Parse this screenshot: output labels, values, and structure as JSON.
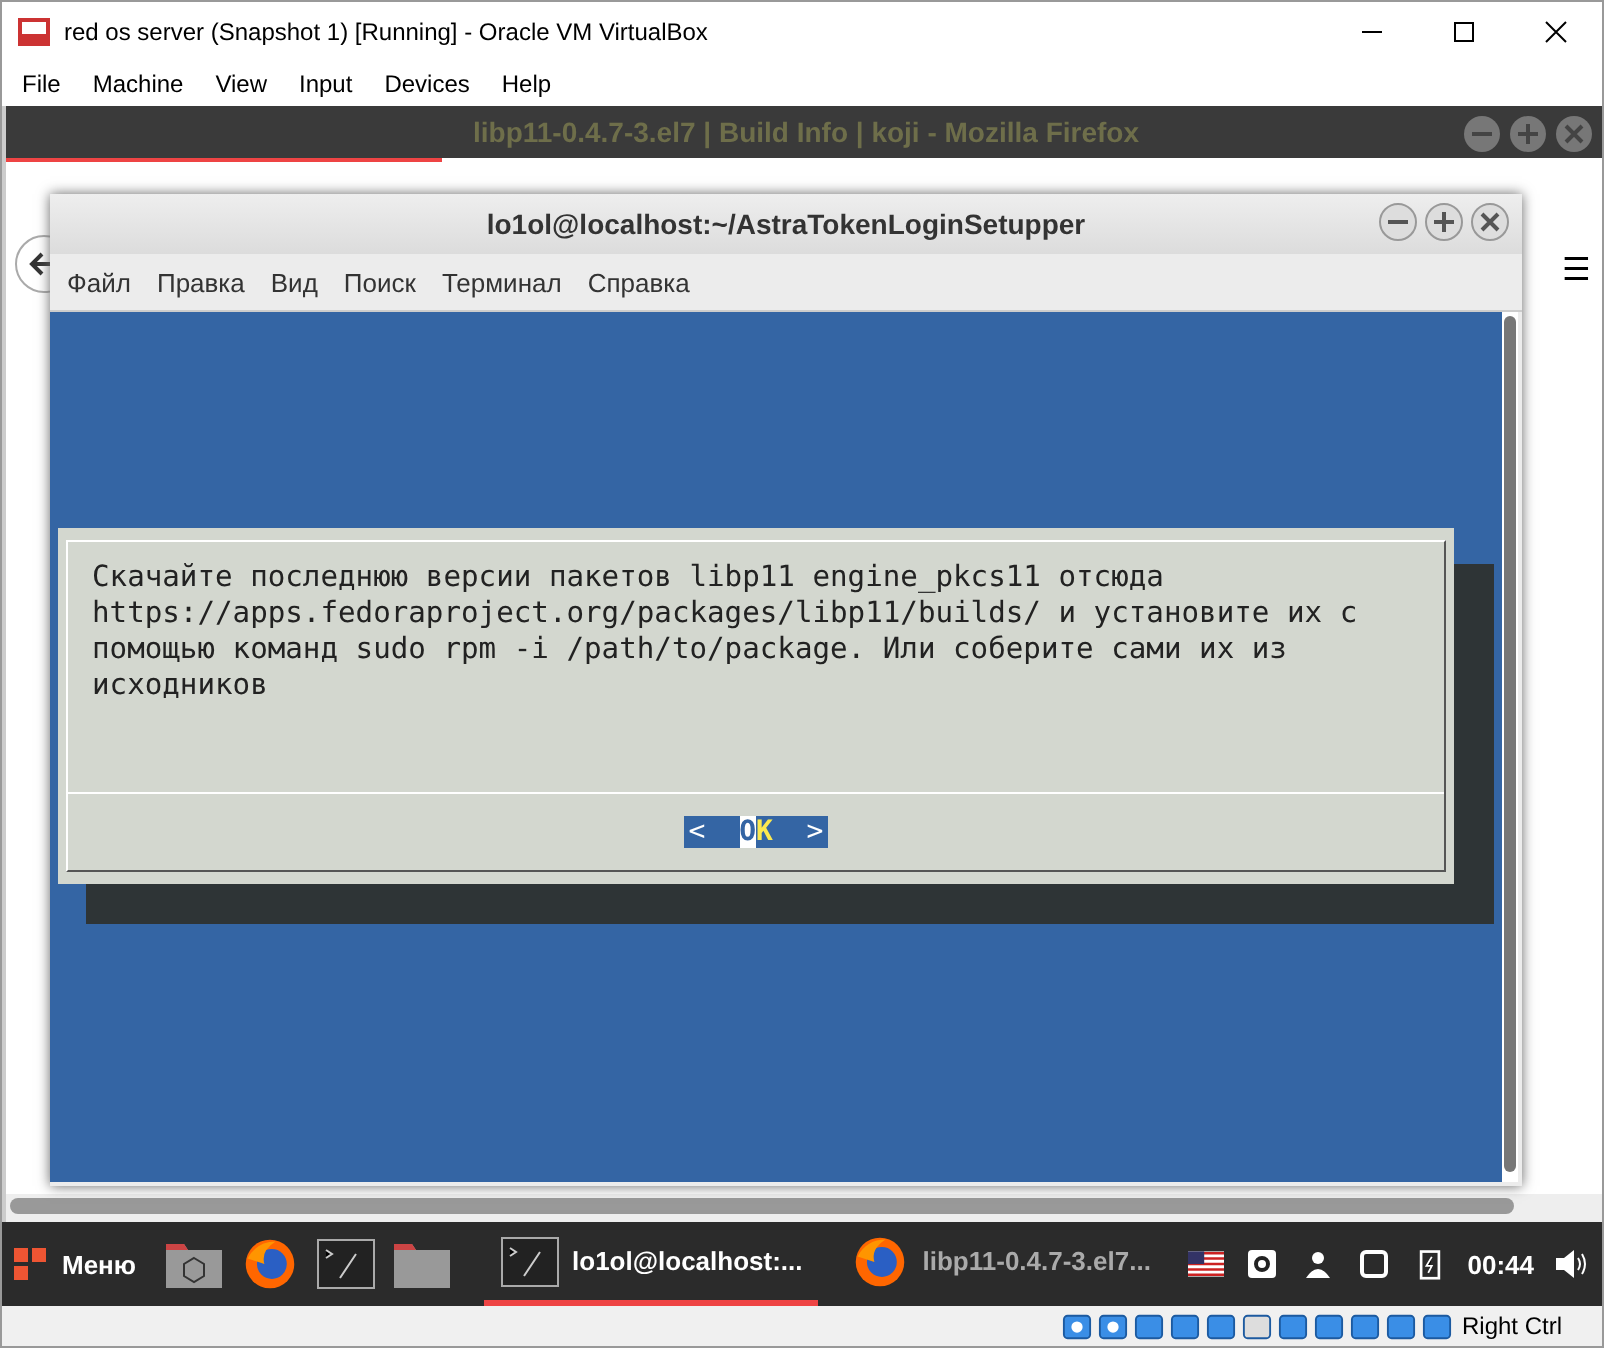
{
  "window": {
    "title": "red os server (Snapshot 1) [Running] - Oracle VM VirtualBox"
  },
  "menu": [
    "File",
    "Machine",
    "View",
    "Input",
    "Devices",
    "Help"
  ],
  "browser": {
    "title": "libp11-0.4.7-3.el7 | Build Info | koji - Mozilla Firefox",
    "menu_icon": "☰"
  },
  "terminal": {
    "title": "lo1ol@localhost:~/AstraTokenLoginSetupper",
    "menu": [
      "Файл",
      "Правка",
      "Вид",
      "Поиск",
      "Терминал",
      "Справка"
    ],
    "dialog": {
      "message": "Скачайте последнюю версии пакетов libp11 engine_pkcs11 отсюда https://apps.fedoraproject.org/packages/libp11/builds/ и установите их с помощью команд sudo rpm -i /path/to/package. Или соберите сами их из исходников",
      "button": {
        "left": "<",
        "label": "OK",
        "right": ">",
        "selected": true
      }
    }
  },
  "taskbar": {
    "menu_label": "Меню",
    "tasks": [
      {
        "kind": "terminal",
        "label": "lo1ol@localhost:...",
        "selected": true
      },
      {
        "kind": "firefox",
        "label": "libp11-0.4.7-3.el7...",
        "selected": false
      }
    ],
    "clock": "00:44"
  },
  "status_bar": {
    "host_key": "Right Ctrl"
  }
}
